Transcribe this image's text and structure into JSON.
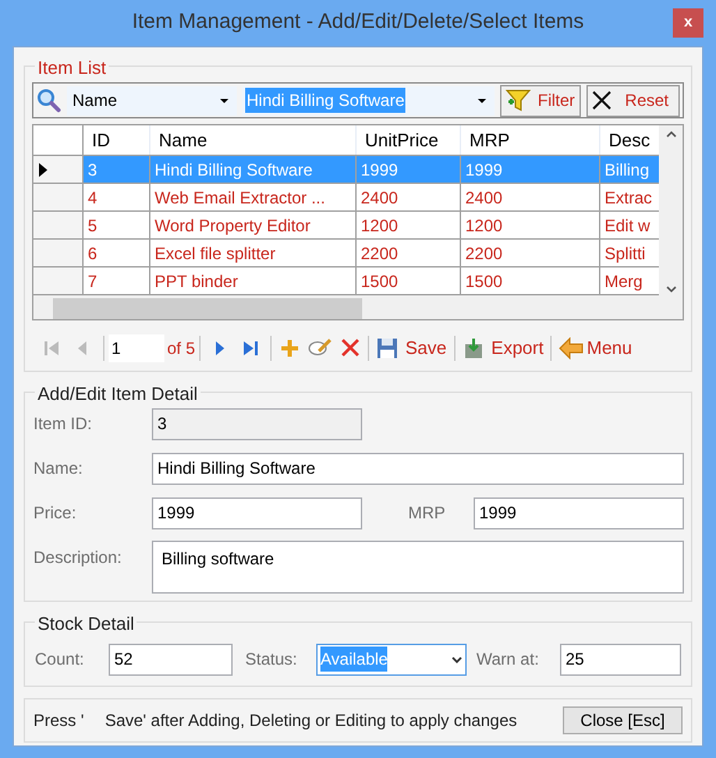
{
  "window": {
    "title": "Item Management - Add/Edit/Delete/Select Items",
    "close": "x"
  },
  "item_list": {
    "legend": "Item List",
    "search": {
      "field": "Name",
      "value": "Hindi Billing Software",
      "filter": "Filter",
      "reset": "Reset"
    },
    "table": {
      "columns": [
        "ID",
        "Name",
        "UnitPrice",
        "MRP",
        "Desc"
      ],
      "rows": [
        {
          "selected": true,
          "cells": [
            "3",
            "Hindi Billing Software",
            "1999",
            "1999",
            "Billing"
          ]
        },
        {
          "selected": false,
          "cells": [
            "4",
            "Web Email Extractor ...",
            "2400",
            "2400",
            "Extrac"
          ]
        },
        {
          "selected": false,
          "cells": [
            "5",
            "Word Property Editor",
            "1200",
            "1200",
            "Edit w"
          ]
        },
        {
          "selected": false,
          "cells": [
            "6",
            "Excel file splitter",
            "2200",
            "2200",
            "Splitti"
          ]
        },
        {
          "selected": false,
          "cells": [
            "7",
            "PPT binder",
            "1500",
            "1500",
            "Merg"
          ]
        }
      ]
    },
    "navigator": {
      "page": "1",
      "of": "of 5",
      "save": "Save",
      "export": "Export",
      "menu": "Menu"
    }
  },
  "item_detail": {
    "legend": "Add/Edit Item Detail",
    "item_id": {
      "label": "Item ID:",
      "value": "3"
    },
    "name": {
      "label": "Name:",
      "value": "Hindi Billing Software"
    },
    "price": {
      "label": "Price:",
      "value": "1999"
    },
    "mrp": {
      "label": "MRP",
      "value": "1999"
    },
    "description": {
      "label": "Description:",
      "value": "Billing software"
    }
  },
  "stock_detail": {
    "legend": "Stock Detail",
    "count": {
      "label": "Count:",
      "value": "52"
    },
    "status": {
      "label": "Status:",
      "value": "Available"
    },
    "warn_at": {
      "label": "Warn at:",
      "value": "25"
    }
  },
  "footer": {
    "hint_start": "Press '",
    "hint_end": "Save' after Adding, Deleting or Editing to apply changes",
    "close": "Close [Esc]"
  }
}
